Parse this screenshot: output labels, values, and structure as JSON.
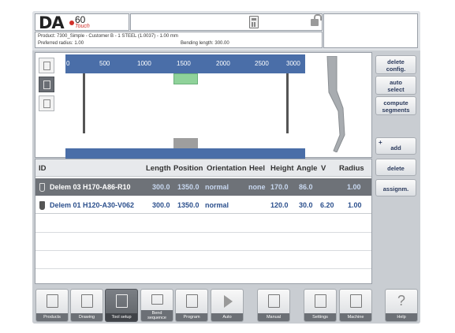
{
  "header": {
    "logo_text": "DA",
    "logo_number": "60",
    "logo_sub": "Touch"
  },
  "info": {
    "product": "Product: 7300_Simple - Customer B - 1 STEEL (1.0037) - 1.00 mm",
    "radius": "Preferred radius: 1.00",
    "bending_length": "Bending length: 300.00"
  },
  "ruler": {
    "ticks": [
      "0",
      "500",
      "1000",
      "1500",
      "2000",
      "2500",
      "3000"
    ]
  },
  "table": {
    "headers": {
      "id": "ID",
      "length": "Length",
      "position": "Position",
      "orientation": "Orientation",
      "heel": "Heel",
      "height": "Height",
      "angle": "Angle",
      "v": "V",
      "radius": "Radius"
    },
    "rows": [
      {
        "id": "Delem 03 H170-A86-R10",
        "length": "300.0",
        "position": "1350.0",
        "orientation": "normal",
        "heel": "none",
        "height": "170.0",
        "angle": "86.0",
        "v": "",
        "radius": "1.00"
      },
      {
        "id": "Delem 01 H120-A30-V062",
        "length": "300.0",
        "position": "1350.0",
        "orientation": "normal",
        "heel": "",
        "height": "120.0",
        "angle": "30.0",
        "v": "6.20",
        "radius": "1.00"
      }
    ]
  },
  "side_buttons": {
    "delete_config_1": "delete",
    "delete_config_2": "config.",
    "auto_select_1": "auto",
    "auto_select_2": "select",
    "compute_1": "compute",
    "compute_2": "segments",
    "add_plus": "+",
    "add": "add",
    "delete": "delete",
    "assign": "assignm."
  },
  "nav": {
    "products": "Products",
    "drawing": "Drawing",
    "tool_setup": "Tool setup",
    "bend_1": "Bend",
    "bend_2": "sequence",
    "program": "Program",
    "auto": "Auto",
    "manual": "Manual",
    "settings": "Settings",
    "machine": "Machine",
    "help": "Help",
    "help_glyph": "?"
  },
  "colors": {
    "ruler_blue": "#4a6ea8",
    "selected_row": "#6e7278",
    "link_blue": "#2b4f8c",
    "upper_tool_green": "#8fd29a"
  }
}
